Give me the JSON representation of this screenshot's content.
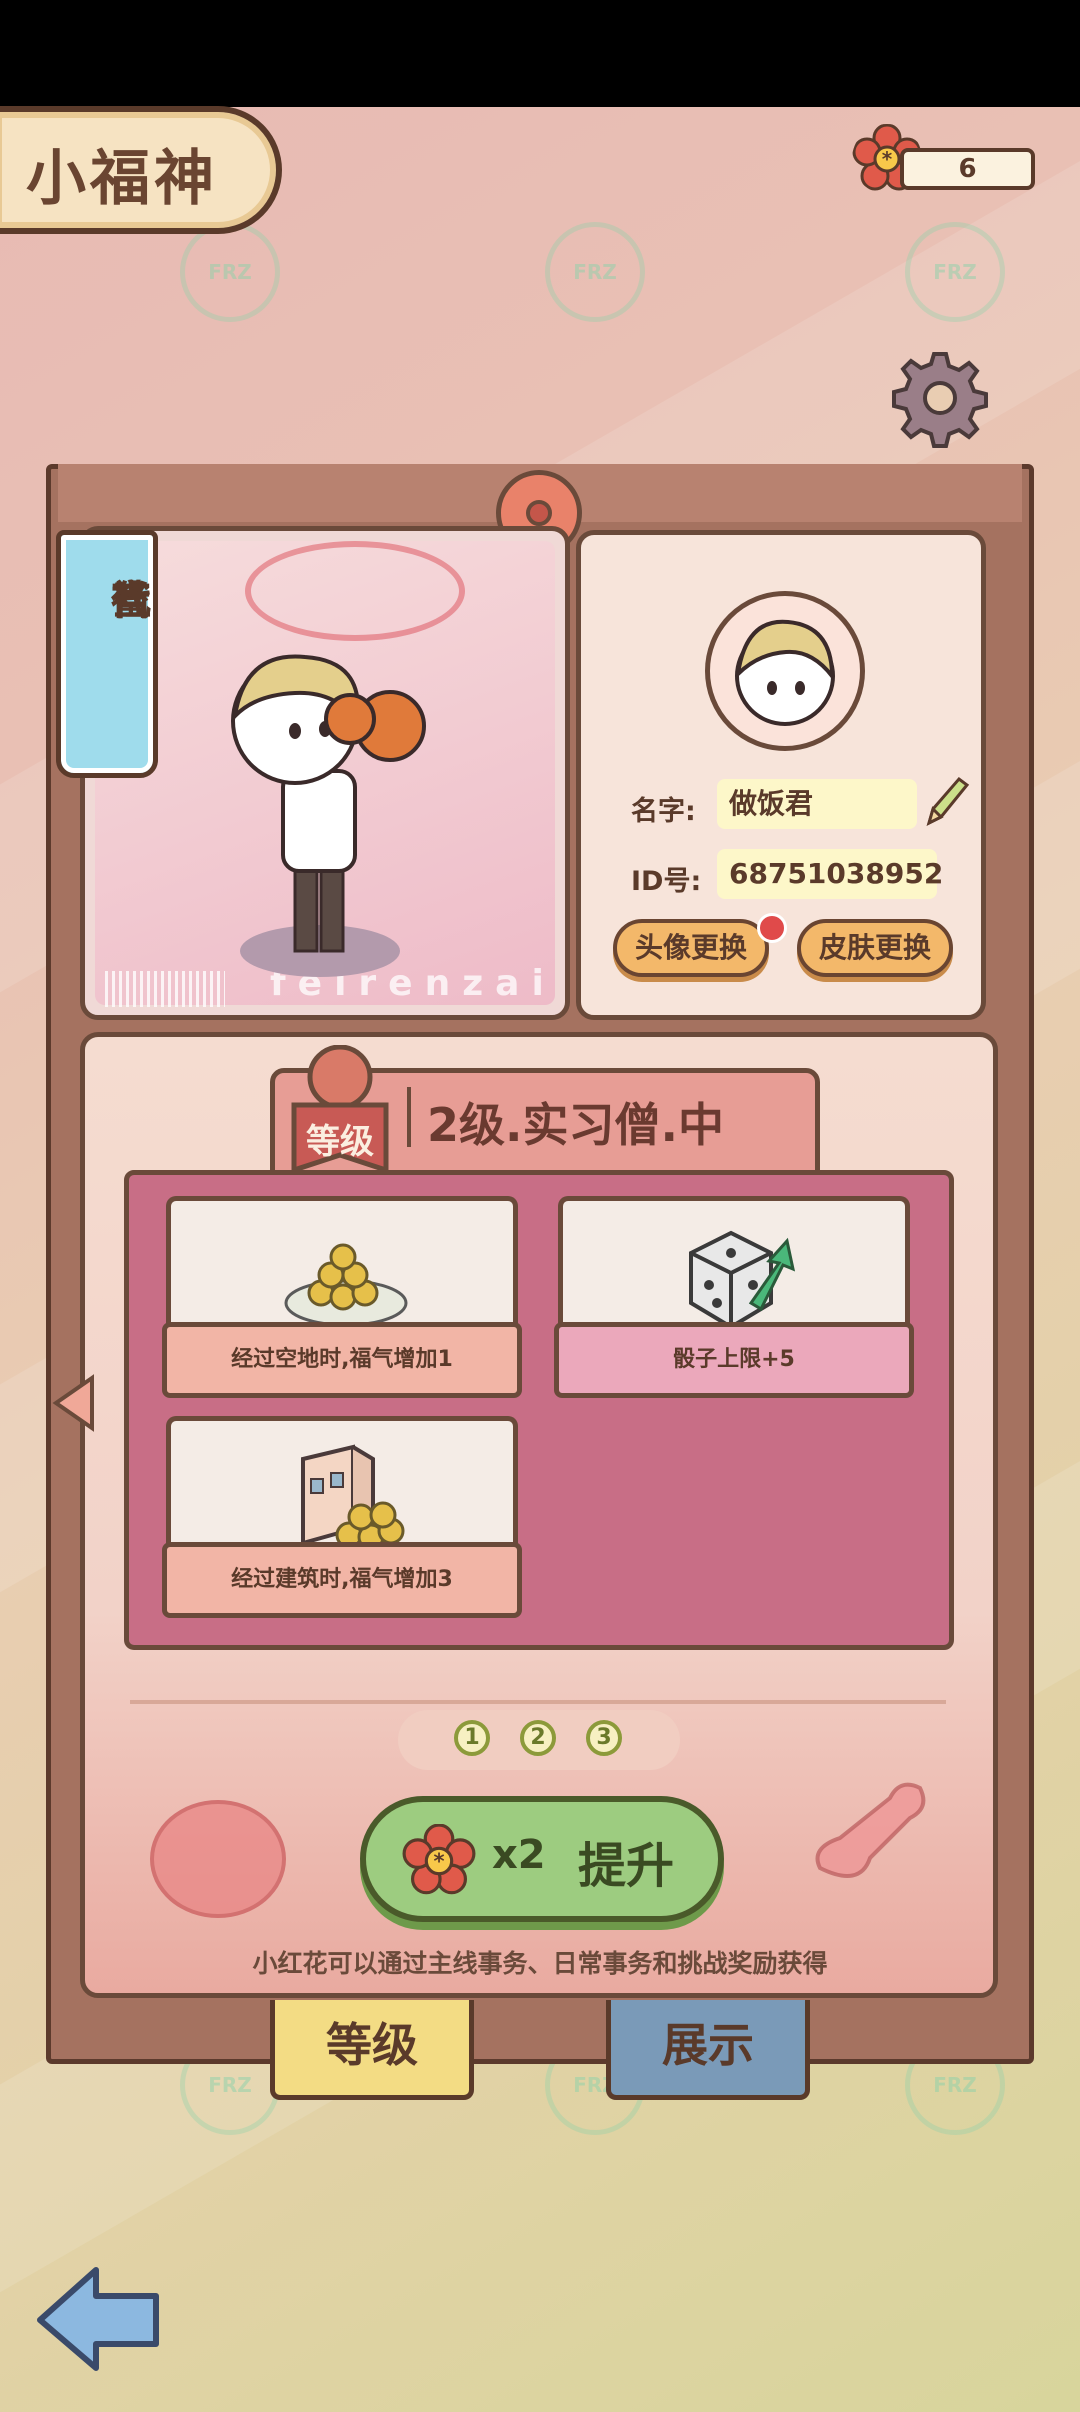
{
  "header": {
    "title": "小福神",
    "flower_count": "6"
  },
  "profile": {
    "rank_badge": [
      "当",
      "代",
      "社",
      "畜"
    ],
    "watermark": "feirenzai",
    "name_label": "名字:",
    "name_value": "做饭君",
    "id_label": "ID号:",
    "id_value": "68751038952",
    "avatar_button": "头像更换",
    "skin_button": "皮肤更换"
  },
  "level": {
    "tag": "等级",
    "title": "2级.实习僧.中",
    "perks": [
      {
        "icon": "coin-pile-icon",
        "text": "经过空地时,福气增加1"
      },
      {
        "icon": "dice-upgrade-icon",
        "text": "骰子上限+5"
      },
      {
        "icon": "building-coins-icon",
        "text": "经过建筑时,福气增加3"
      }
    ],
    "pages": [
      "1",
      "2",
      "3"
    ],
    "upgrade_multiplier": "x2",
    "upgrade_label": "提升",
    "hint": "小红花可以通过主线事务、日常事务和挑战奖励获得"
  },
  "tabs": {
    "level": "等级",
    "display": "展示"
  },
  "colors": {
    "accent": "#9dcc80",
    "brown": "#5a3a2a",
    "flower": "#e05a4a"
  }
}
